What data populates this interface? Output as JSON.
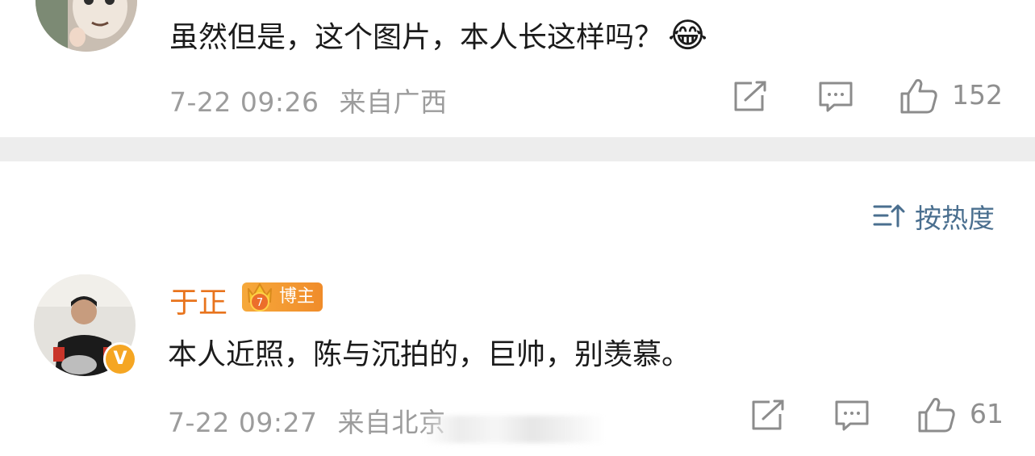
{
  "comments": [
    {
      "text": "虽然但是，这个图片，本人长这样吗？",
      "emoji": "😂",
      "time": "7-22 09:26",
      "location": "来自广西",
      "likes": "152",
      "avatar_icon": "cartoon-avatar-icon"
    },
    {
      "username": "于正",
      "badge_label": "博主",
      "text": "本人近照，陈与沉拍的，巨帅，别羡慕。",
      "time": "7-22 09:27",
      "location": "来自北京",
      "likes": "61",
      "avatar_icon": "user-avatar-icon",
      "verified_symbol": "V"
    }
  ],
  "sort": {
    "label": "按热度",
    "icon": "sort-icon"
  },
  "colors": {
    "username": "#e8741d",
    "badge": "#f5a033",
    "sort_link": "#4a6f8f",
    "meta_gray": "#9c9c9c",
    "divider": "#ededed",
    "verified": "#f5a623"
  }
}
